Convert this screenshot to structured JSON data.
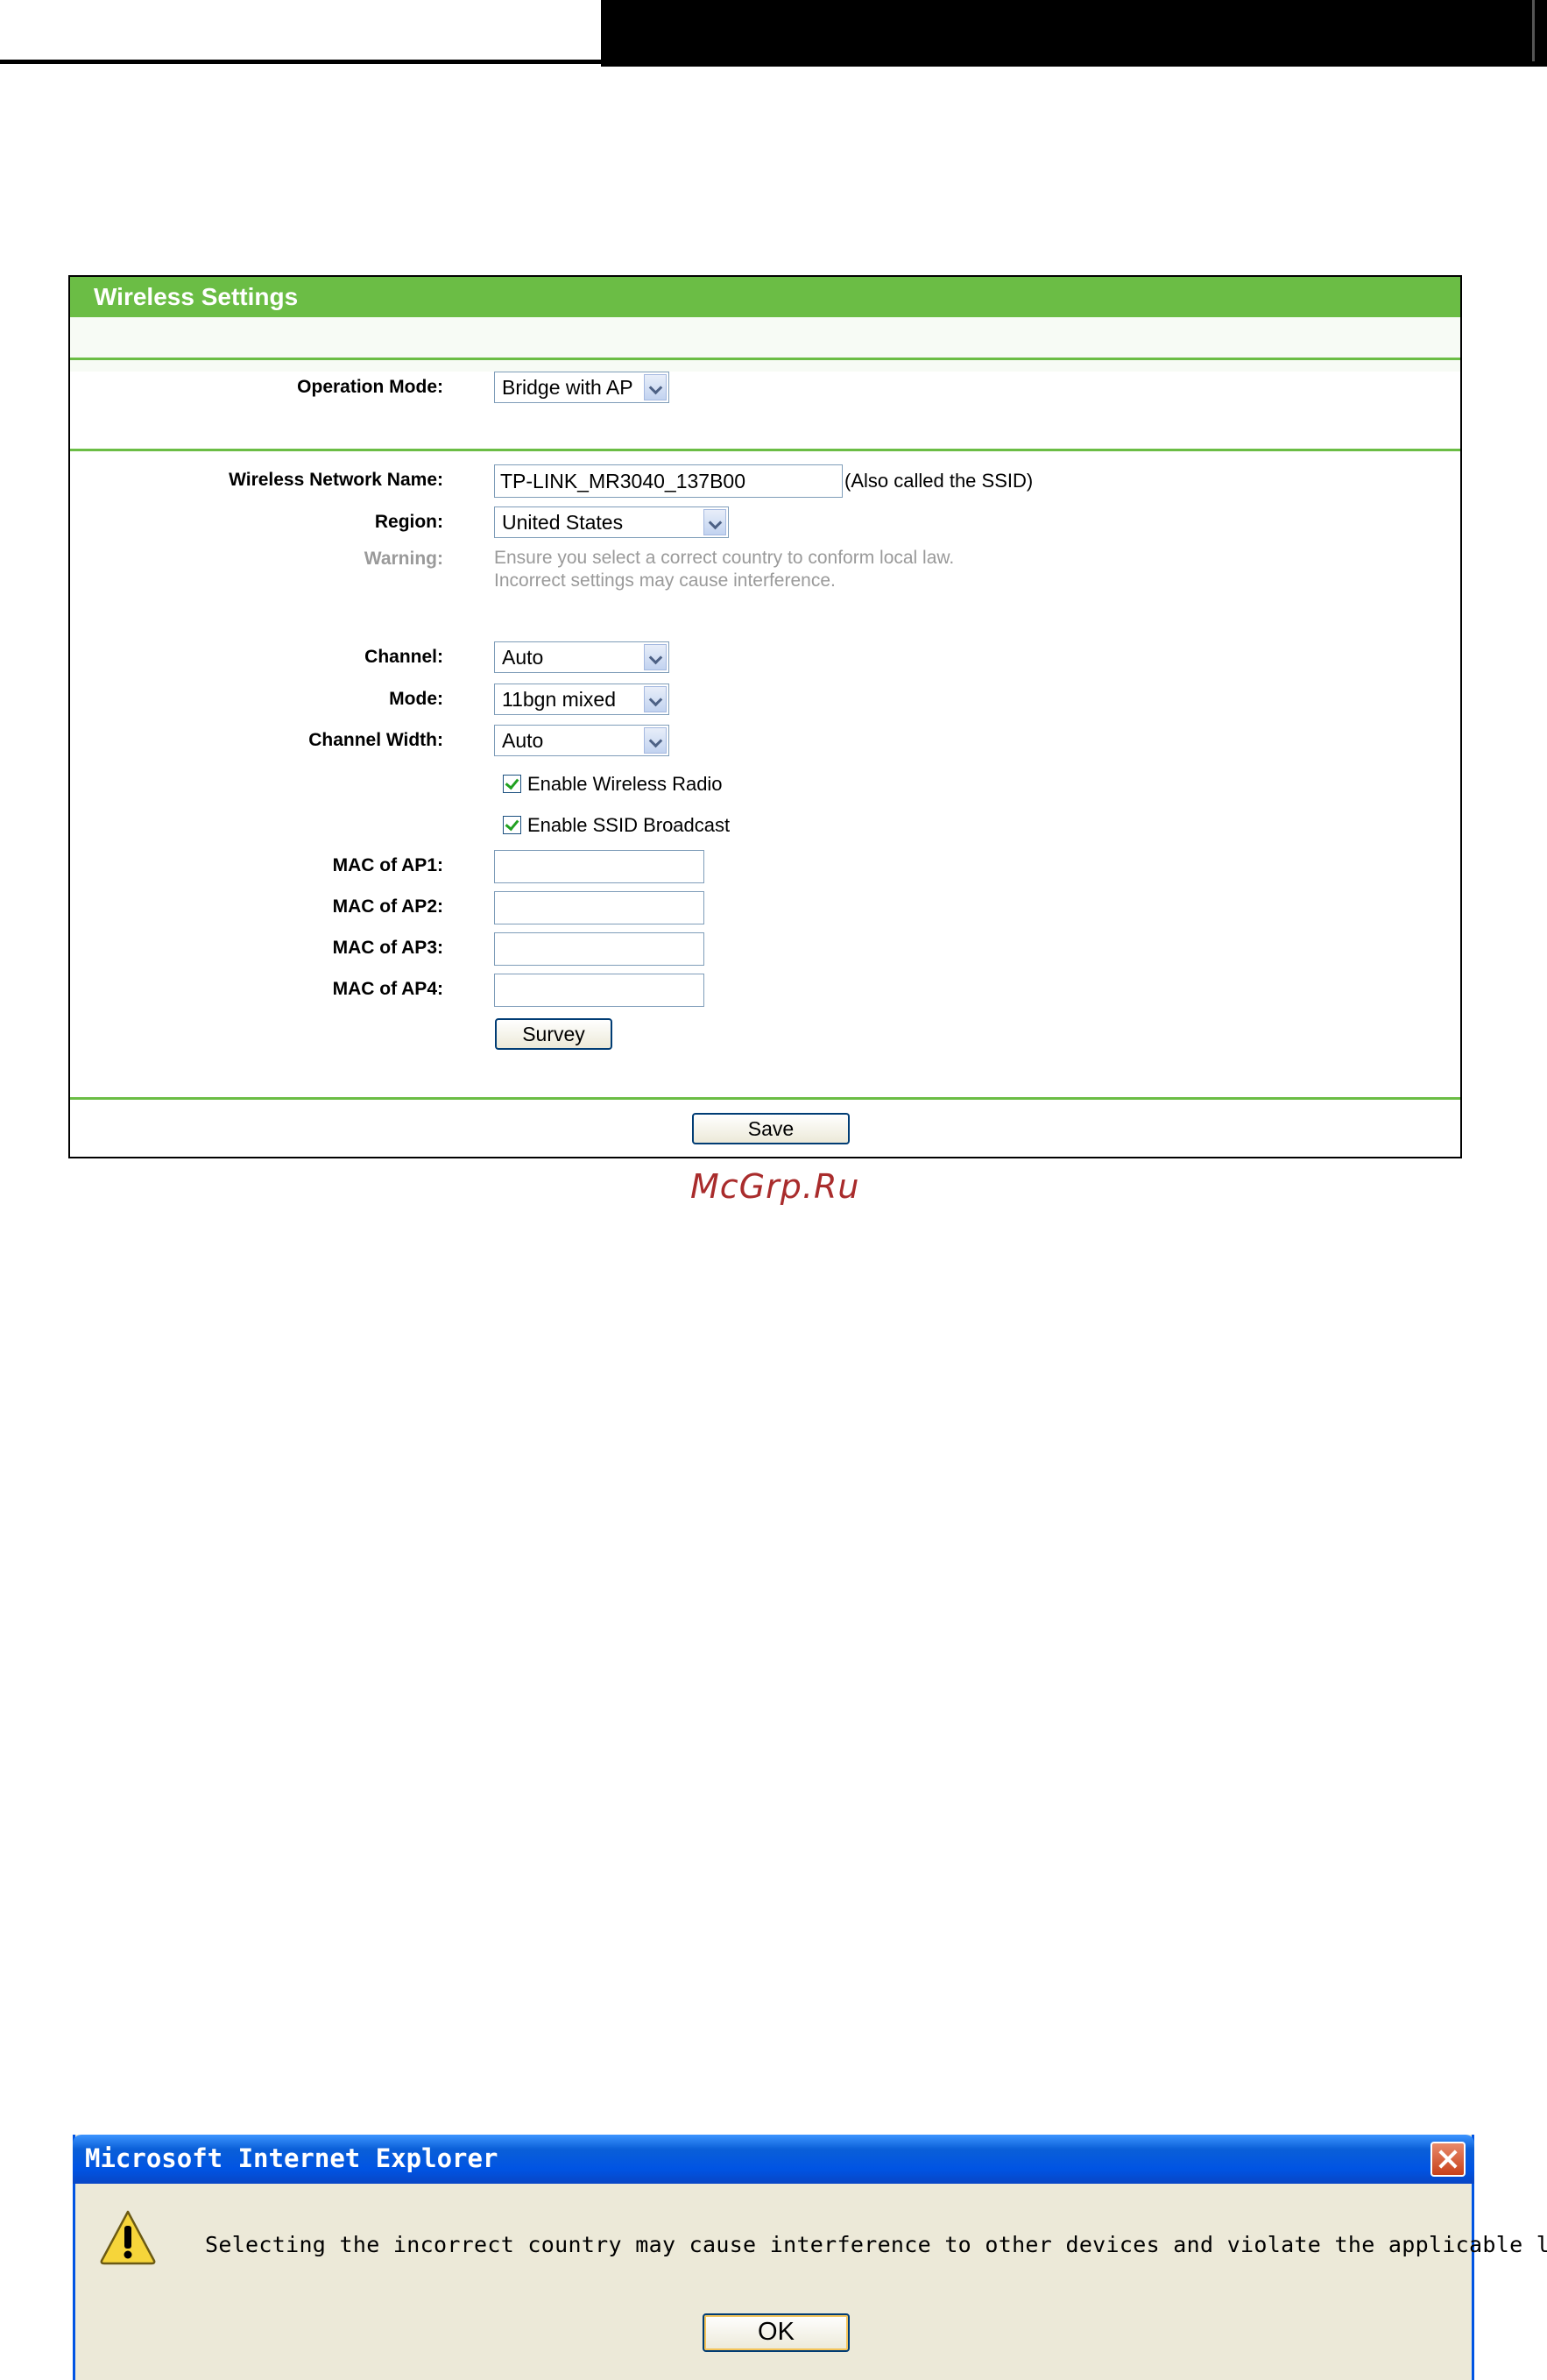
{
  "wireless_settings": {
    "title": "Wireless Settings",
    "operation_mode": {
      "label": "Operation Mode:",
      "value": "Bridge with AP"
    },
    "network_name": {
      "label": "Wireless Network Name:",
      "value": "TP-LINK_MR3040_137B00",
      "note": "(Also called the SSID)"
    },
    "region": {
      "label": "Region:",
      "value": "United States"
    },
    "warning": {
      "label": "Warning:",
      "line1": "Ensure you select a correct country to conform local law.",
      "line2": "Incorrect settings may cause interference."
    },
    "channel": {
      "label": "Channel:",
      "value": "Auto"
    },
    "mode": {
      "label": "Mode:",
      "value": "11bgn mixed"
    },
    "channel_width": {
      "label": "Channel Width:",
      "value": "Auto"
    },
    "enable_wireless_radio": {
      "label": "Enable Wireless Radio",
      "checked": true
    },
    "enable_ssid_broadcast": {
      "label": "Enable SSID Broadcast",
      "checked": true
    },
    "mac_ap1": {
      "label": "MAC of AP1:",
      "value": ""
    },
    "mac_ap2": {
      "label": "MAC of AP2:",
      "value": ""
    },
    "mac_ap3": {
      "label": "MAC of AP3:",
      "value": ""
    },
    "mac_ap4": {
      "label": "MAC of AP4:",
      "value": ""
    },
    "survey_label": "Survey",
    "save_label": "Save"
  },
  "watermark": "McGrp.Ru",
  "dialog": {
    "title": "Microsoft Internet Explorer",
    "message": "Selecting the incorrect country may cause interference to other devices and violate the applicable law.",
    "ok_label": "OK",
    "icon": "warning-icon"
  },
  "colors": {
    "panel_green": "#6bbd45",
    "xp_blue": "#0054e3",
    "dialog_bg": "#ece9d8"
  }
}
